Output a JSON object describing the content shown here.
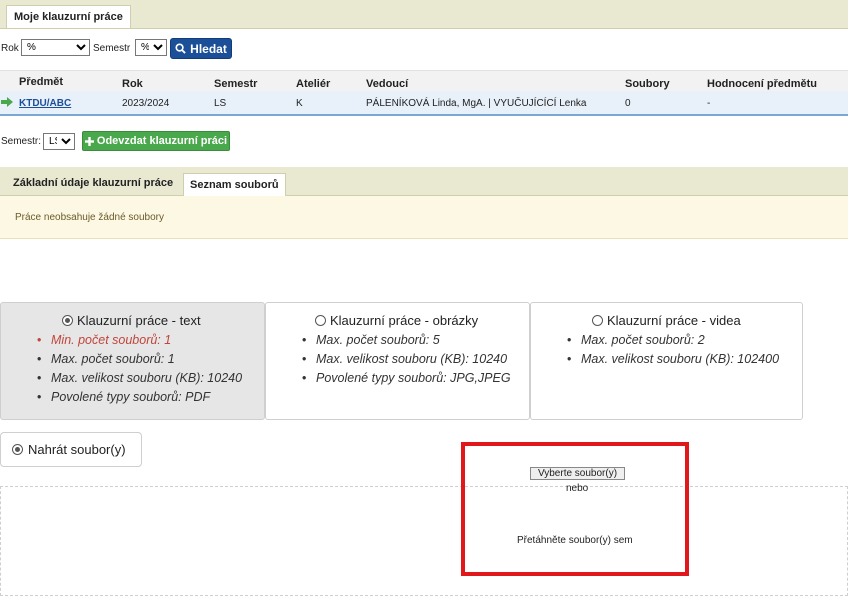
{
  "top_tab": "Moje klauzurní práce",
  "filters": {
    "year_label": "Rok",
    "year_value": "%",
    "semester_label": "Semestr",
    "semester_value": "%",
    "search_button": "Hledat"
  },
  "table": {
    "headers": [
      "Předmět",
      "Rok",
      "Semestr",
      "Ateliér",
      "Vedoucí",
      "Soubory",
      "Hodnocení předmětu"
    ],
    "row": {
      "subject": "KTDU/ABC",
      "year": "2023/2024",
      "semester": "LS",
      "atelier": "K",
      "supervisor": "PÁLENÍKOVÁ Linda, MgA. | VYUČUJÍCÍCÍ Lenka",
      "files": "0",
      "evaluation": "-"
    }
  },
  "semester_select": {
    "label": "Semestr:",
    "value": "LS"
  },
  "submit_button": "Odevzdat klauzurní práci",
  "tabs2": {
    "basic": "Základní údaje klauzurní práce",
    "files": "Seznam souborů"
  },
  "notice": "Práce neobsahuje žádné soubory",
  "options": [
    {
      "title": "Klauzurní práce - text",
      "selected": true,
      "items": [
        "Min. počet souborů: 1",
        "Max. počet souborů: 1",
        "Max. velikost souboru (KB): 10240",
        "Povolené typy souborů: PDF"
      ]
    },
    {
      "title": "Klauzurní práce - obrázky",
      "selected": false,
      "items": [
        "Max. počet souborů: 5",
        "Max. velikost souboru (KB): 10240",
        "Povolené typy souborů: JPG,JPEG"
      ]
    },
    {
      "title": "Klauzurní práce - videa",
      "selected": false,
      "items": [
        "Max. počet souborů: 2",
        "Max. velikost souboru (KB): 102400"
      ]
    }
  ],
  "upload": {
    "label": "Nahrát soubor(y)",
    "choose_button": "Vyberte soubor(y)",
    "or": "nebo",
    "drag_text": "Přetáhněte soubor(y) sem"
  },
  "colors": {
    "accent_blue": "#1b4f98",
    "green": "#4aa84c",
    "highlight": "#e0171b"
  }
}
